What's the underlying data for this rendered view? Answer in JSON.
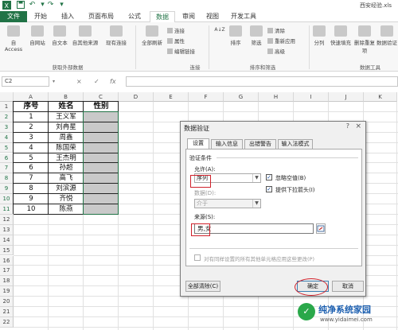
{
  "titlebar": {
    "file_title": "西安经验.xls",
    "icons": [
      "excel-logo-icon",
      "save-icon",
      "undo-icon",
      "redo-icon",
      "customize-icon"
    ]
  },
  "ribbon_tabs": [
    "文件",
    "开始",
    "插入",
    "页面布局",
    "公式",
    "数据",
    "审阅",
    "视图",
    "开发工具"
  ],
  "active_tab": "数据",
  "ribbon": {
    "group_get_external": {
      "label": "获取外部数据",
      "buttons": [
        "自 Access",
        "自网站",
        "自文本",
        "自其他来源",
        "现有连接"
      ]
    },
    "group_connections": {
      "label": "连接",
      "refresh_label": "全部刷新",
      "small": [
        "连接",
        "属性",
        "编辑链接"
      ]
    },
    "group_sort_filter": {
      "label": "排序和筛选",
      "sort_az": "A↓Z",
      "sort_label": "排序",
      "filter_label": "筛选",
      "small": [
        "清除",
        "重新应用",
        "高级"
      ]
    },
    "group_data_tools": {
      "label": "数据工具",
      "buttons": [
        "分列",
        "快速填充",
        "删除重复项",
        "数据验证"
      ]
    }
  },
  "formula_bar": {
    "name_box": "C2",
    "cancel": "×",
    "enter": "✓",
    "fx": "fx",
    "value": ""
  },
  "columns": [
    "A",
    "B",
    "C",
    "D",
    "E",
    "F",
    "G",
    "H",
    "I",
    "J",
    "K"
  ],
  "rows": [
    "1",
    "2",
    "3",
    "4",
    "5",
    "6",
    "7",
    "8",
    "9",
    "10",
    "11",
    "12",
    "13",
    "14",
    "15",
    "16",
    "17",
    "18",
    "19",
    "20",
    "21",
    "22"
  ],
  "table": {
    "headers": [
      "序号",
      "姓名",
      "性别"
    ],
    "records": [
      {
        "no": "1",
        "name": "王义军"
      },
      {
        "no": "2",
        "name": "刘冉星"
      },
      {
        "no": "3",
        "name": "周鑫"
      },
      {
        "no": "4",
        "name": "陈国荣"
      },
      {
        "no": "5",
        "name": "王杰明"
      },
      {
        "no": "6",
        "name": "孙超"
      },
      {
        "no": "7",
        "name": "高飞"
      },
      {
        "no": "8",
        "name": "刘滨源"
      },
      {
        "no": "9",
        "name": "齐悦"
      },
      {
        "no": "10",
        "name": "陈燕"
      }
    ]
  },
  "dialog": {
    "title": "数据验证",
    "help": "?",
    "close": "×",
    "tabs": [
      "设置",
      "输入信息",
      "出错警告",
      "输入法模式"
    ],
    "section": "验证条件",
    "allow_label": "允许(A):",
    "allow_value": "序列",
    "ignore_blank": {
      "label": "忽略空值(B)",
      "checked": true
    },
    "dropdown_arrow": {
      "label": "提供下拉箭头(I)",
      "checked": true
    },
    "data_label": "数据(D):",
    "data_value": "介于",
    "source_label": "来源(S):",
    "source_value": "男,女",
    "apply_all": {
      "label": "对有同样设置的所有其他单元格应用这些更改(P)",
      "checked": false
    },
    "clear_all": "全部清除(C)",
    "ok": "确定",
    "cancel": "取消"
  },
  "watermark": {
    "text": "纯净系统家园",
    "url": "www.yidaimei.com"
  },
  "colors": {
    "excel_green": "#217346",
    "highlight_red": "#d0202a",
    "gray_fill": "#c9c9c9"
  }
}
